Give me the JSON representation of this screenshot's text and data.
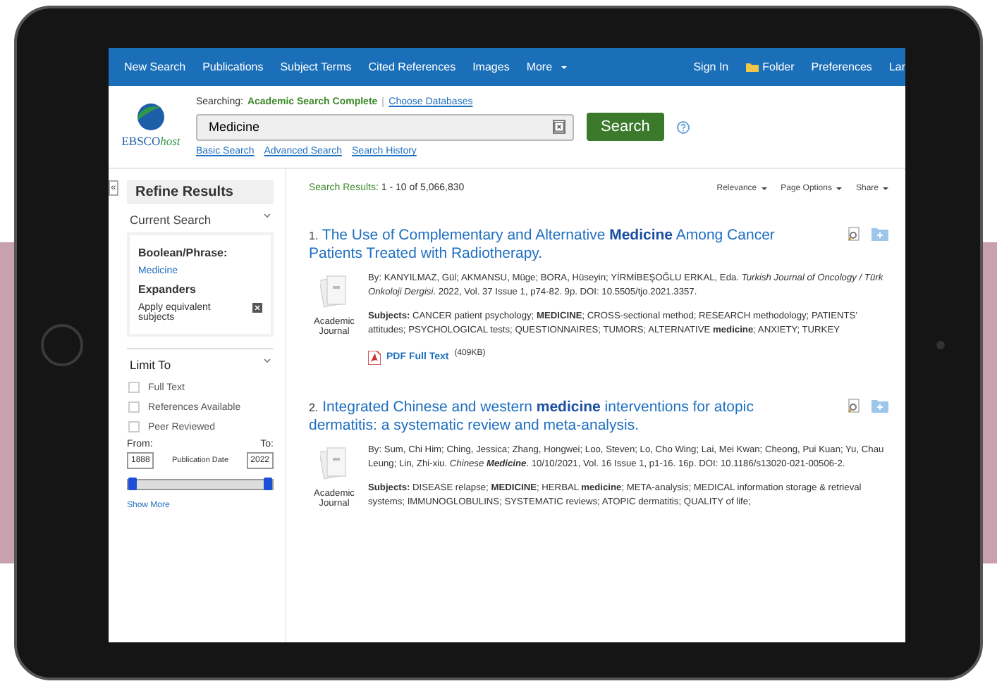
{
  "nav": {
    "left": [
      {
        "label": "New Search",
        "kind": "link"
      },
      {
        "label": "Publications",
        "kind": "link"
      },
      {
        "label": "Subject Terms",
        "kind": "link"
      },
      {
        "label": "Cited References",
        "kind": "link"
      },
      {
        "label": "Images",
        "kind": "link"
      },
      {
        "label": "More",
        "kind": "menu"
      }
    ],
    "right": [
      {
        "label": "Sign In",
        "kind": "link"
      },
      {
        "label": "Folder",
        "kind": "folder"
      },
      {
        "label": "Preferences",
        "kind": "link"
      },
      {
        "label": "Lar",
        "kind": "link"
      }
    ]
  },
  "logo": {
    "main": "EBSCO",
    "sub": "host"
  },
  "search": {
    "searching_label": "Searching:",
    "database": "Academic Search Complete",
    "choose_link": "Choose Databases",
    "value": "Medicine",
    "button": "Search",
    "links": [
      "Basic Search",
      "Advanced Search",
      "Search History"
    ]
  },
  "sidebar": {
    "collapse": "«",
    "title": "Refine Results",
    "current_search": {
      "heading": "Current Search",
      "boolean_label": "Boolean/Phrase:",
      "boolean_value": "Medicine",
      "expanders_label": "Expanders",
      "expander": "Apply equivalent subjects"
    },
    "limit_to": {
      "heading": "Limit To",
      "options": [
        {
          "label": "Full Text",
          "checked": false
        },
        {
          "label": "References Available",
          "checked": false
        },
        {
          "label": "Peer Reviewed",
          "checked": false
        }
      ],
      "from_label": "From:",
      "to_label": "To:",
      "from_value": "1888",
      "date_label": "Publication Date",
      "to_value": "2022",
      "slider_thumbs": [
        {
          "level": 0
        },
        {
          "level": 1
        }
      ]
    },
    "show_more": "Show More"
  },
  "results": {
    "summary_label": "Search Results:",
    "summary_value": "1 - 10 of 5,066,830",
    "menus": [
      "Relevance",
      "Page Options",
      "Share"
    ],
    "items": [
      {
        "number": "1.",
        "title": "The Use of Complementary and Alternative **Medicine** Among Cancer Patients Treated with Radiotherapy.",
        "byline": "By: KANYILMAZ, Gül; AKMANSU, Müge; BORA, Hüseyin; YİRMİBEŞOĞLU ERKAL, Eda. *Turkish Journal of Oncology / Türk Onkoloji Dergisi*. 2022, Vol. 37 Issue 1, p74-82. 9p. DOI: 10.5505/tjo.2021.3357.",
        "type": "Academic Journal",
        "subjects": "**Subjects:** CANCER patient psychology; **MEDICINE**; CROSS-sectional method; RESEARCH methodology; PATIENTS' attitudes; PSYCHOLOGICAL tests; QUESTIONNAIRES; TUMORS; ALTERNATIVE **medicine**; ANXIETY; TURKEY",
        "pdf_label": "PDF Full Text",
        "pdf_size": "(409KB)"
      },
      {
        "number": "2.",
        "title": "Integrated Chinese and western **medicine** interventions for atopic dermatitis: a systematic review and meta-analysis.",
        "byline": "By: Sum, Chi Him; Ching, Jessica; Zhang, Hongwei; Loo, Steven; Lo, Cho Wing; Lai, Mei Kwan; Cheong, Pui Kuan; Yu, Chau Leung; Lin, Zhi-xiu. *Chinese* **Medicine**. 10/10/2021, Vol. 16 Issue 1, p1-16. 16p. DOI: 10.1186/s13020-021-00506-2.",
        "type": "Academic Journal",
        "subjects": "**Subjects:** DISEASE relapse; **MEDICINE**; HERBAL **medicine**; META-analysis; MEDICAL information storage & retrieval systems; IMMUNOGLOBULINS; SYSTEMATIC reviews; ATOPIC dermatitis; QUALITY of life;"
      }
    ]
  }
}
